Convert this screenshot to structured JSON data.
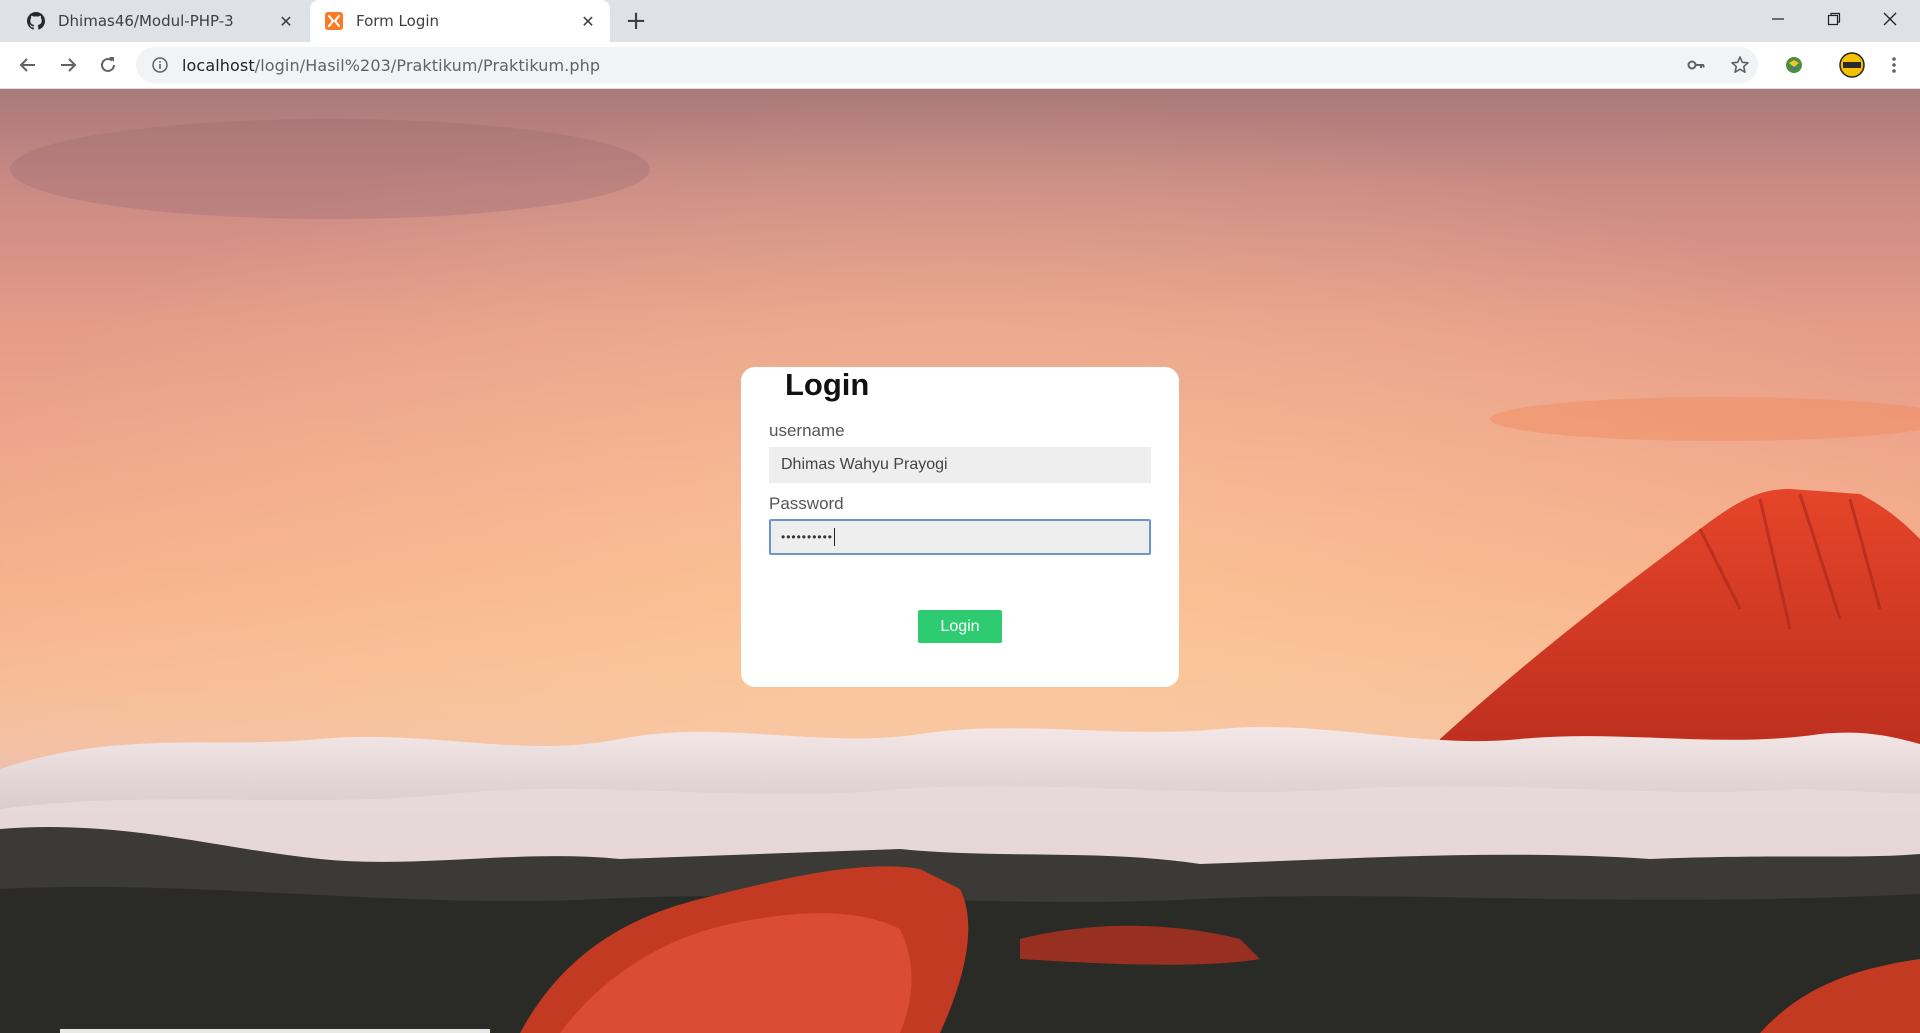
{
  "browser": {
    "tabs": [
      {
        "title": "Dhimas46/Modul-PHP-3",
        "icon": "github-icon",
        "active": false
      },
      {
        "title": "Form Login",
        "icon": "xampp-icon",
        "active": true
      }
    ],
    "url_host": "localhost",
    "url_path": "/login/Hasil%203/Praktikum/Praktikum.php"
  },
  "login": {
    "title": "Login",
    "username_label": "username",
    "username_value": "Dhimas Wahyu Prayogi",
    "password_label": "Password",
    "password_value": "••••••••••",
    "button_label": "Login"
  },
  "colors": {
    "button": "#2ecc71",
    "focus_border": "#6e95c8",
    "tab_strip": "#dee1e6"
  }
}
